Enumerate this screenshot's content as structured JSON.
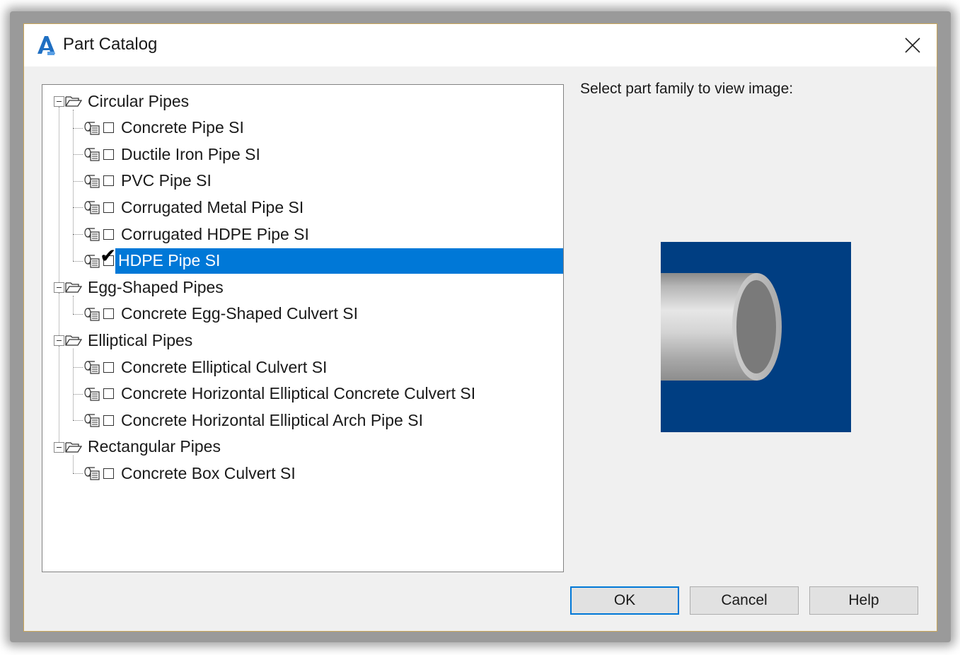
{
  "window": {
    "title": "Part Catalog",
    "close_glyph": "✕"
  },
  "tree": {
    "groups": [
      {
        "label": "Circular Pipes",
        "items": [
          {
            "label": "Concrete Pipe SI",
            "checked": false
          },
          {
            "label": "Ductile Iron Pipe SI",
            "checked": false
          },
          {
            "label": "PVC Pipe SI",
            "checked": false
          },
          {
            "label": "Corrugated Metal Pipe SI",
            "checked": false
          },
          {
            "label": "Corrugated HDPE Pipe SI",
            "checked": false
          },
          {
            "label": "HDPE Pipe SI",
            "checked": true,
            "selected": true
          }
        ]
      },
      {
        "label": "Egg-Shaped Pipes",
        "items": [
          {
            "label": "Concrete Egg-Shaped Culvert SI",
            "checked": false
          }
        ]
      },
      {
        "label": "Elliptical Pipes",
        "items": [
          {
            "label": "Concrete Elliptical Culvert SI",
            "checked": false
          },
          {
            "label": "Concrete Horizontal Elliptical Concrete Culvert SI",
            "checked": false
          },
          {
            "label": "Concrete Horizontal Elliptical Arch Pipe SI",
            "checked": false
          }
        ]
      },
      {
        "label": "Rectangular Pipes",
        "items": [
          {
            "label": "Concrete Box Culvert SI",
            "checked": false
          }
        ]
      }
    ]
  },
  "preview": {
    "prompt": "Select part family to view image:",
    "background_color": "#003e82"
  },
  "buttons": {
    "ok": "OK",
    "cancel": "Cancel",
    "help": "Help"
  },
  "colors": {
    "selection": "#0078d7",
    "app_icon": "#1f6fc2"
  }
}
